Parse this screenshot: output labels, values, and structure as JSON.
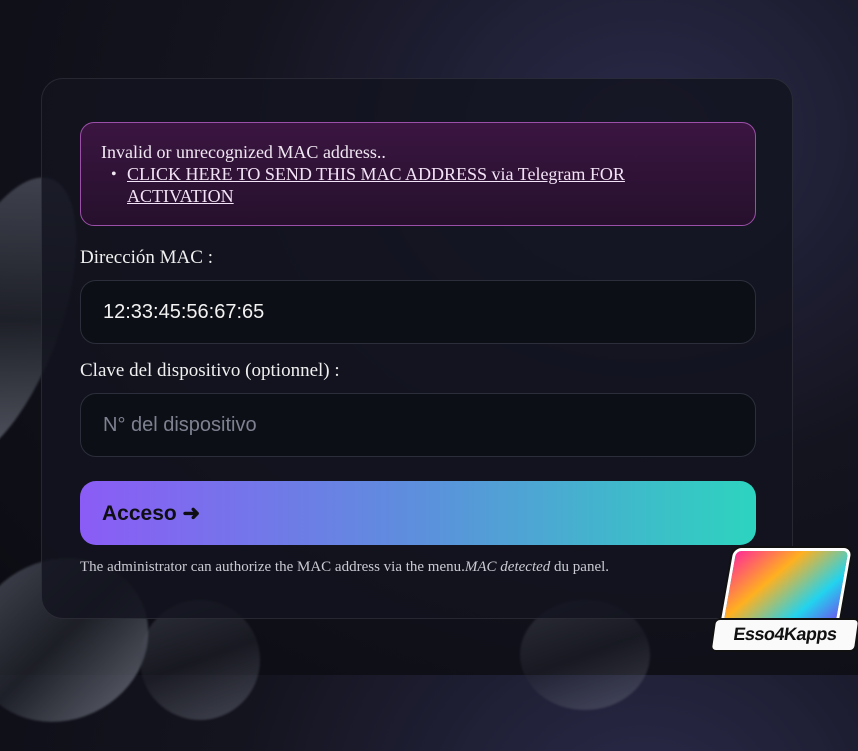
{
  "alert": {
    "message": "Invalid or unrecognized MAC address..",
    "link_text": "CLICK HERE TO SEND THIS MAC ADDRESS via Telegram FOR ACTIVATION"
  },
  "form": {
    "mac_label": "Dirección MAC :",
    "mac_value": "12:33:45:56:67:65",
    "key_label": "Clave del dispositivo (optionnel) :",
    "key_placeholder": "N° del dispositivo",
    "submit_label": "Acceso ➜"
  },
  "footnote": {
    "text_before": "The administrator can authorize the MAC address via the menu.",
    "emphasis": "MAC detected",
    "text_after": " du panel."
  },
  "logo": {
    "text": "Esso4Kapps"
  },
  "colors": {
    "alert_border": "#9b4fa8",
    "button_gradient_start": "#8b5cf6",
    "button_gradient_end": "#2dd4bf"
  }
}
